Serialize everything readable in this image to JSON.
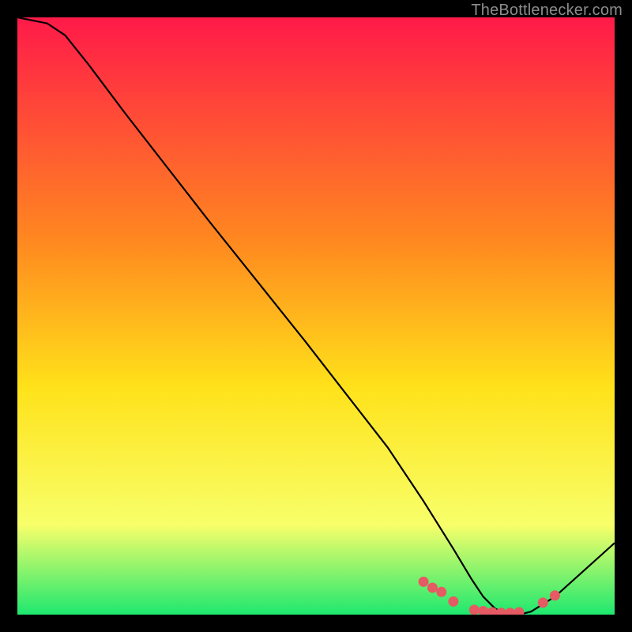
{
  "watermark": "TheBottlenecker.com",
  "colors": {
    "bg": "#000000",
    "gradient_top": "#ff1a49",
    "gradient_mid1": "#ff8a1f",
    "gradient_mid2": "#ffe21a",
    "gradient_mid3": "#f8ff6a",
    "gradient_bottom": "#1ee86f",
    "curve": "#000000",
    "marker": "#e55a63",
    "watermark": "#8c8c8c"
  },
  "chart_data": {
    "type": "line",
    "x": [
      0,
      5,
      8,
      12,
      18,
      25,
      32,
      40,
      48,
      55,
      62,
      68,
      73,
      76,
      78,
      80,
      82,
      84,
      86,
      90,
      95,
      100
    ],
    "values": [
      100,
      99,
      97,
      92,
      84,
      75,
      66,
      56,
      46,
      37,
      28,
      19,
      11,
      6,
      3,
      1,
      0,
      0,
      0.5,
      3,
      7.5,
      12
    ],
    "markers_x": [
      68,
      69.5,
      71,
      73,
      76.5,
      78,
      79.5,
      81,
      82.5,
      84,
      88,
      90
    ],
    "markers_y": [
      5.5,
      4.5,
      3.8,
      2.2,
      0.8,
      0.6,
      0.4,
      0.3,
      0.3,
      0.4,
      2.0,
      3.2
    ],
    "xlim": [
      0,
      100
    ],
    "ylim": [
      0,
      100
    ],
    "title": "",
    "xlabel": "",
    "ylabel": ""
  }
}
